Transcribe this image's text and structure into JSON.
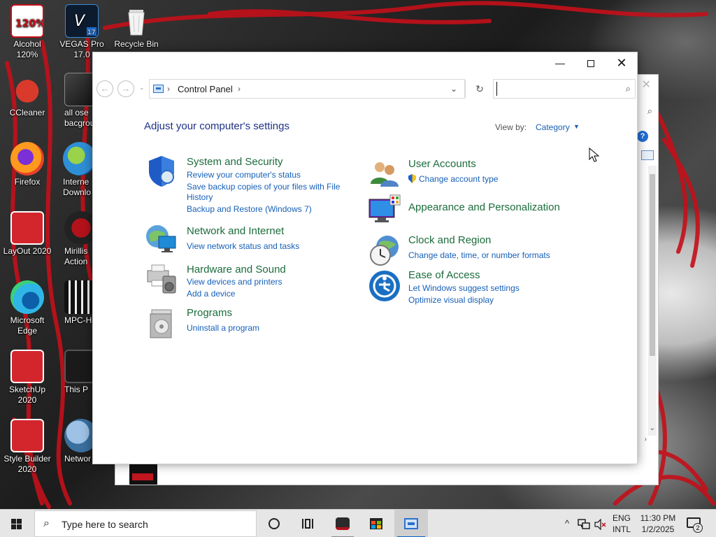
{
  "desktop": {
    "icons": [
      {
        "label": "Alcohol\n120%",
        "label_line1": "Alcohol",
        "label_line2": "120%",
        "icon": "alcohol-120-icon"
      },
      {
        "label_line1": "VEGAS Pro",
        "label_line2": "17.0",
        "icon": "vegas-pro-icon"
      },
      {
        "label_line1": "Recycle Bin",
        "label_line2": "",
        "icon": "recycle-bin-icon"
      },
      {
        "label_line1": "CCleaner",
        "label_line2": "",
        "icon": "ccleaner-icon"
      },
      {
        "label_line1": "all ose",
        "label_line2": "bacgrour",
        "icon": "all-ose-background-icon"
      },
      {
        "label_line1": "Firefox",
        "label_line2": "",
        "icon": "firefox-icon"
      },
      {
        "label_line1": "Interne",
        "label_line2": "Downlo",
        "icon": "internet-download-manager-icon"
      },
      {
        "label_line1": "LayOut 2020",
        "label_line2": "",
        "icon": "layout-2020-icon"
      },
      {
        "label_line1": "Mirillis",
        "label_line2": "Action",
        "icon": "mirillis-action-icon"
      },
      {
        "label_line1": "Microsoft",
        "label_line2": "Edge",
        "icon": "microsoft-edge-icon"
      },
      {
        "label_line1": "MPC-H",
        "label_line2": "",
        "icon": "mpc-hc-icon"
      },
      {
        "label_line1": "SketchUp",
        "label_line2": "2020",
        "icon": "sketchup-2020-icon"
      },
      {
        "label_line1": "This P",
        "label_line2": "",
        "icon": "this-pc-icon"
      },
      {
        "label_line1": "Style Builder",
        "label_line2": "2020",
        "icon": "style-builder-2020-icon"
      },
      {
        "label_line1": "Networ",
        "label_line2": "",
        "icon": "network-icon"
      }
    ]
  },
  "window": {
    "title_buttons": {
      "minimize": "—",
      "close": "✕"
    },
    "nav": {
      "back": "←",
      "forward": "→",
      "recent": "⌄"
    },
    "address": {
      "separator": "›",
      "crumb": "Control Panel",
      "dropdown": "⌄",
      "refresh": "↻"
    },
    "search": {
      "value": "",
      "placeholder": ""
    },
    "heading": "Adjust your computer's settings",
    "view_by_label": "View by:",
    "view_by_value": "Category",
    "categories": [
      {
        "title": "System and Security",
        "icon": "system-security-shield-icon",
        "links": [
          "Review your computer's status",
          "Save backup copies of your files with File History",
          "Backup and Restore (Windows 7)"
        ]
      },
      {
        "title": "Network and Internet",
        "icon": "network-internet-globe-icon",
        "links": [
          "View network status and tasks"
        ]
      },
      {
        "title": "Hardware and Sound",
        "icon": "hardware-sound-printer-icon",
        "links": [
          "View devices and printers",
          "Add a device"
        ]
      },
      {
        "title": "Programs",
        "icon": "programs-disc-icon",
        "links": [
          "Uninstall a program"
        ]
      },
      {
        "title": "User Accounts",
        "icon": "user-accounts-icon",
        "links": [
          "Change account type"
        ]
      },
      {
        "title": "Appearance and Personalization",
        "icon": "appearance-personalization-icon",
        "links": []
      },
      {
        "title": "Clock and Region",
        "icon": "clock-region-icon",
        "links": [
          "Change date, time, or number formats"
        ]
      },
      {
        "title": "Ease of Access",
        "icon": "ease-of-access-icon",
        "links": [
          "Let Windows suggest settings",
          "Optimize visual display"
        ]
      }
    ]
  },
  "background_window": {
    "close": "✕",
    "search": "⌕",
    "help": "?",
    "scroll_up": "⌃",
    "scroll_down": "⌄",
    "scroll_right": "›"
  },
  "taskbar": {
    "search_placeholder": "Type here to search",
    "items": [
      "cortana",
      "task-view",
      "republic-of-gamers",
      "microsoft-store",
      "control-panel"
    ],
    "tray": {
      "chevron": "^",
      "language_line1": "ENG",
      "language_line2": "INTL",
      "time": "11:30 PM",
      "date": "1/2/2025",
      "notification_count": "2"
    }
  },
  "colors": {
    "heading": "#1e3287",
    "category_title": "#1c6c3c",
    "link": "#1660b9",
    "taskbar": "#e6e6e6",
    "accent": "#0a64c8"
  }
}
